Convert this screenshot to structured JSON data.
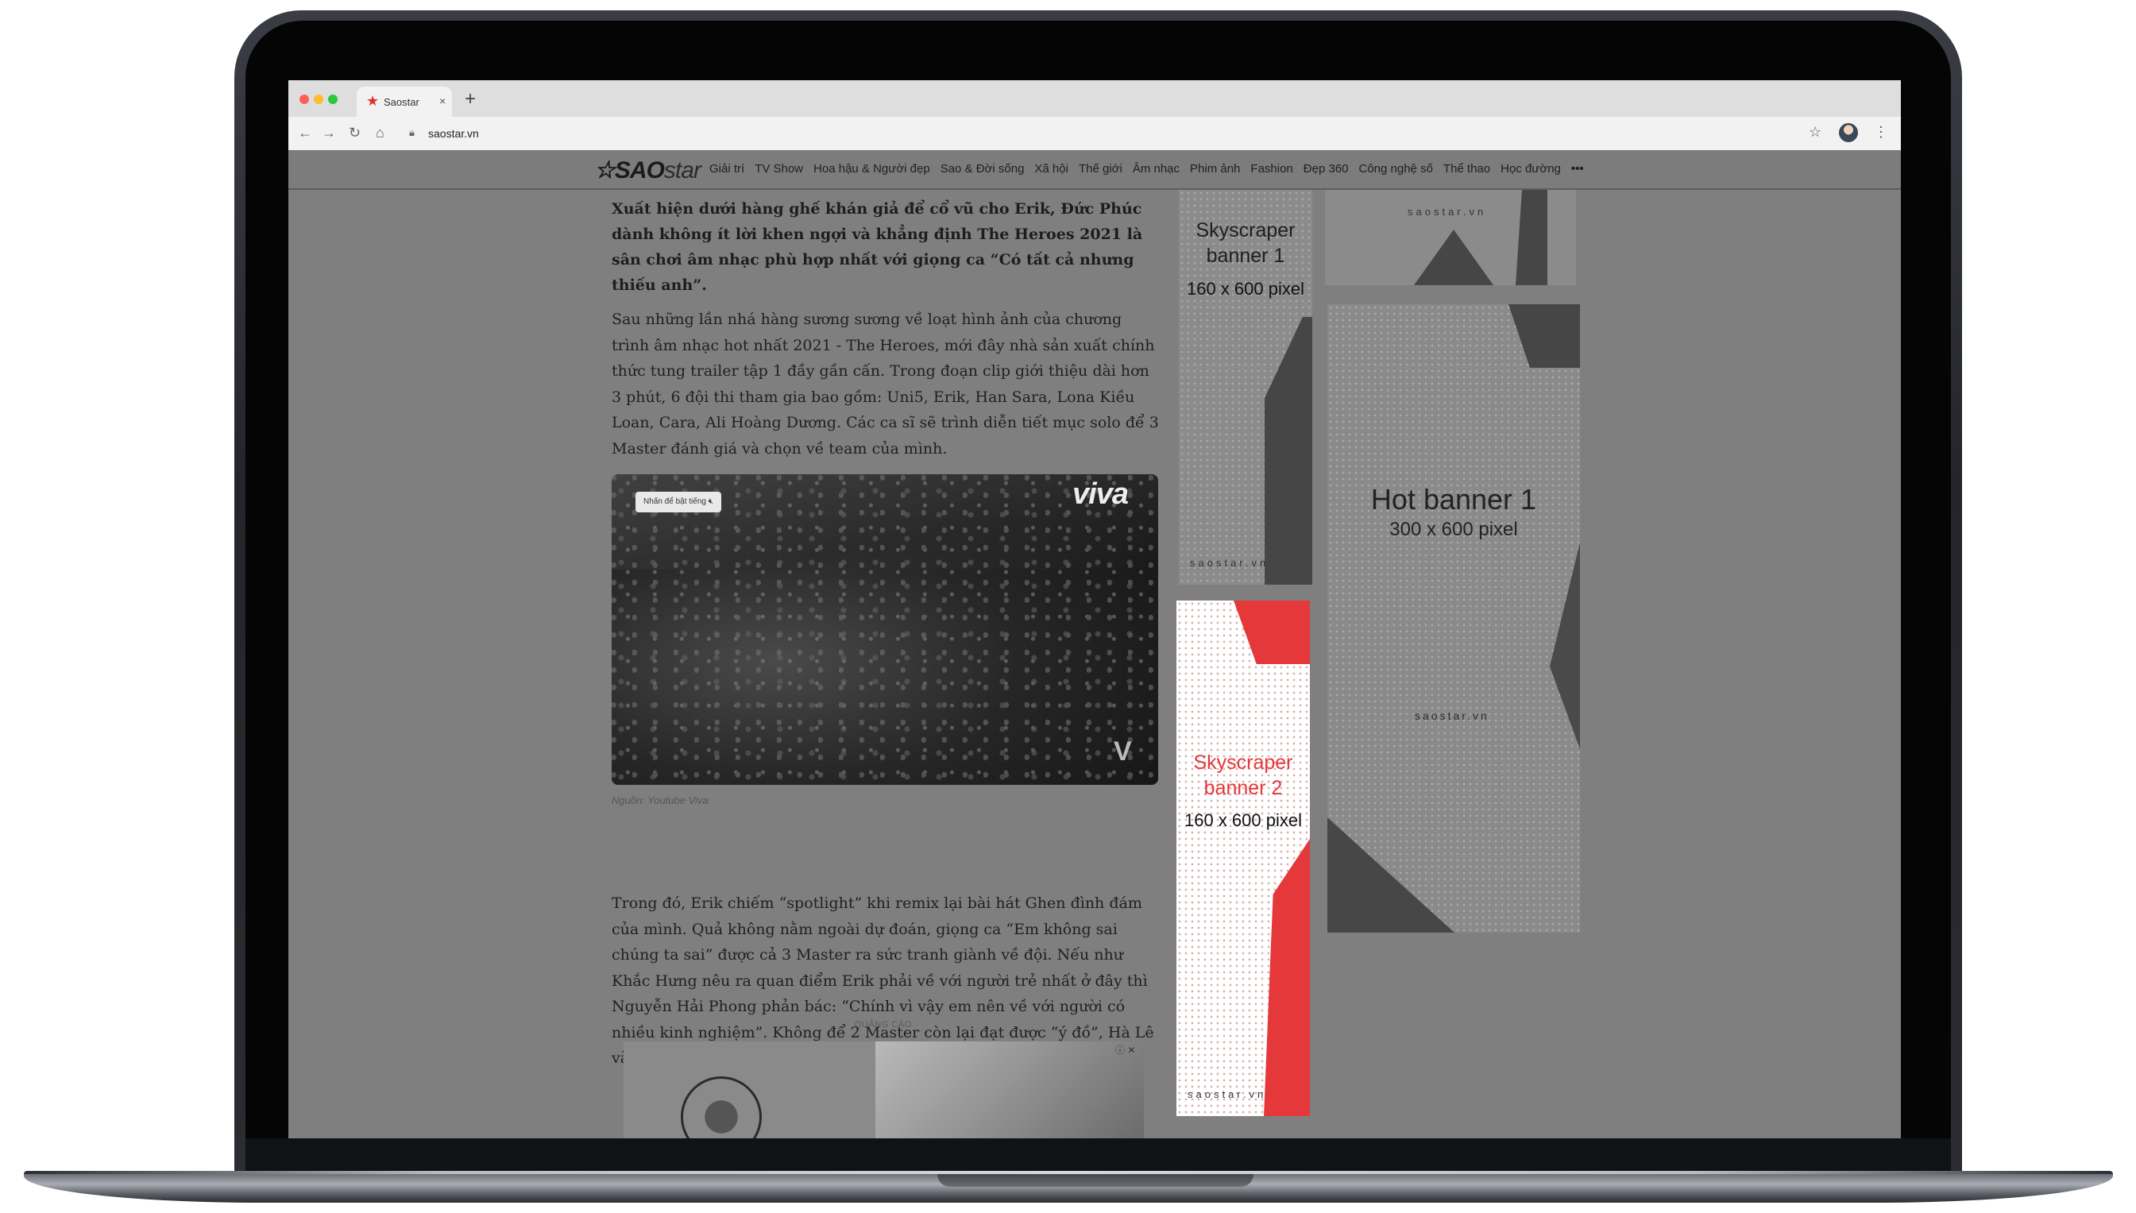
{
  "browser": {
    "tab_title": "Saostar",
    "tab_close": "×",
    "new_tab": "+",
    "url": "saostar.vn",
    "icons": [
      "back-arrow-icon",
      "forward-arrow-icon",
      "reload-icon",
      "home-icon",
      "lock-icon",
      "bookmark-star-icon",
      "profile-avatar",
      "kebab-menu-icon"
    ]
  },
  "site": {
    "logo_bold": "SAO",
    "logo_light": "star",
    "nav": [
      "Giải trí",
      "TV Show",
      "Hoa hậu & Người đẹp",
      "Sao & Đời sống",
      "Xã hội",
      "Thế giới",
      "Âm nhạc",
      "Phim ảnh",
      "Fashion",
      "Đẹp 360",
      "Công nghệ số",
      "Thể thao",
      "Học đường"
    ],
    "nav_more": "•••"
  },
  "article": {
    "lead": "Xuất hiện dưới hàng ghế khán giả để cổ vũ cho Erik, Đức Phúc dành không ít lời khen ngợi và khẳng định The Heroes 2021 là sân chơi âm nhạc phù hợp nhất với giọng ca “Có tất cả nhưng thiếu anh”.",
    "para1": "Sau những lần nhá hàng sương sương về loạt hình ảnh của chương trình âm nhạc hot nhất 2021 - The Heroes, mới đây nhà sản xuất chính thức tung trailer tập 1 đầy gần cấn. Trong đoạn clip giới thiệu dài hơn 3 phút, 6 đội thi tham gia bao gồm: Uni5, Erik, Han Sara, Lona Kiều Loan, Cara, Ali Hoàng Dương. Các ca sĩ sẽ trình diễn tiết mục solo để 3 Master đánh giá và chọn về team của mình.",
    "video_mute_label": "Nhấn để bật tiếng",
    "video_brand": "viva",
    "video_corner": "V",
    "caption": "Nguồn: Youtube Viva",
    "para2": "Trong đó, Erik chiếm “spotlight” khi remix lại bài hát Ghen đình đám của mình. Quả không nằm ngoài dự đoán, giọng ca “Em không sai chúng ta sai” được cả 3 Master ra sức tranh giành về đội. Nếu như Khắc Hưng nêu ra quan điểm Erik phải về với người trẻ nhất ở đây thì Nguyễn Hải Phong phản bác: “Chính vì vậy em nên về với người có nhiều kinh nghiệm”. Không để 2 Master còn lại đạt được “ý đồ”, Hà Lê và Nimbia cho rằng cả hai mới là Master phù hợp nhất với Erik.",
    "ad_label": "QUẢNG CÁO",
    "ad_close": "ⓘ ✕"
  },
  "ads": {
    "sky1_title": "Skyscraper banner 1",
    "sky1_size": "160 x 600 pixel",
    "sky1_brand": "saostar.vn",
    "top_right_brand": "saostar.vn",
    "hot_title": "Hot banner 1",
    "hot_size": "300 x 600 pixel",
    "hot_brand": "saostar.vn",
    "sky2_title": "Skyscraper banner 2",
    "sky2_size": "160 x 600 pixel",
    "sky2_brand": "saostar.vn",
    "accent_red": "#e5383b"
  }
}
